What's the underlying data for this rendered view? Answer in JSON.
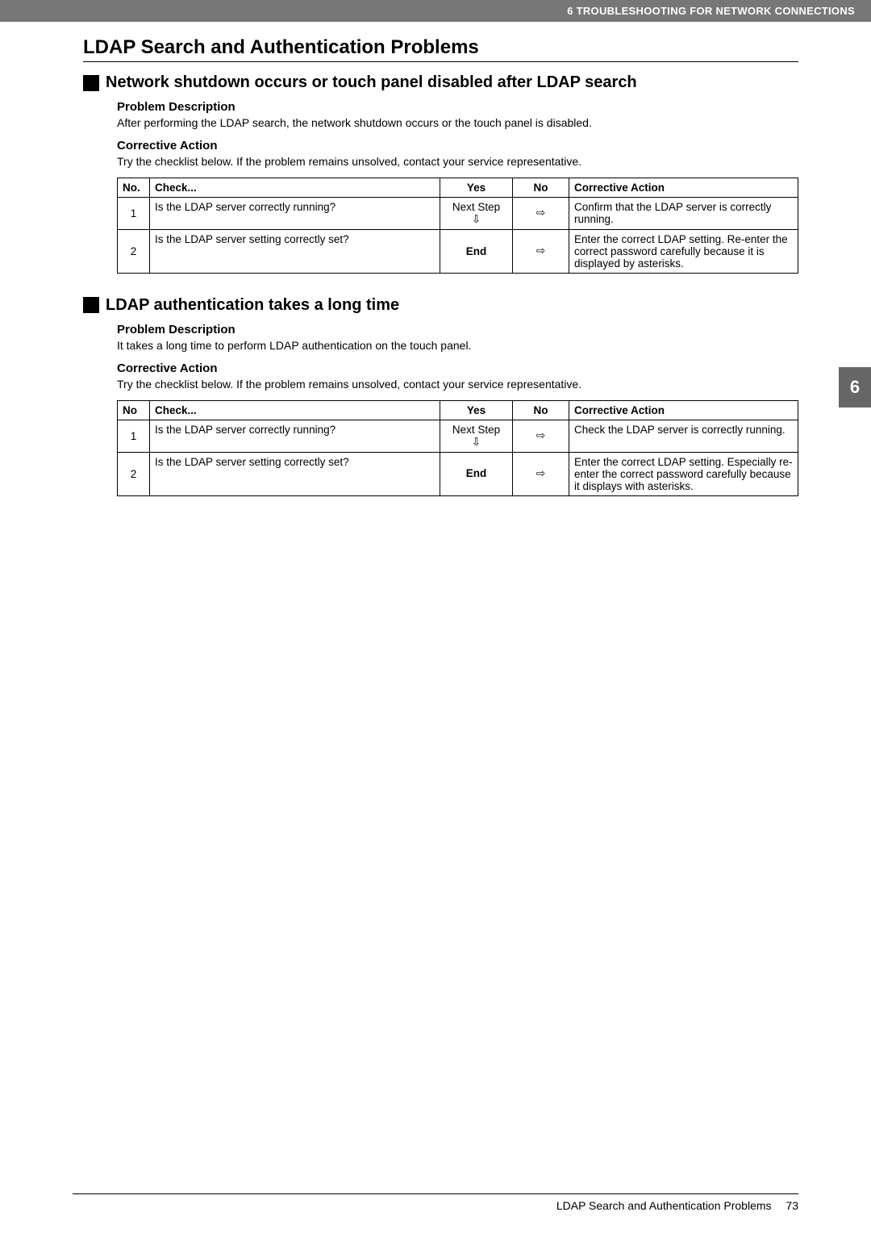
{
  "header": "6 TROUBLESHOOTING FOR NETWORK CONNECTIONS",
  "title": "LDAP Search and Authentication Problems",
  "section1": {
    "heading": "Network shutdown occurs or touch panel disabled after LDAP search",
    "pd_label": "Problem Description",
    "pd_text": "After performing the LDAP search, the network shutdown occurs or the touch panel is disabled.",
    "ca_label": "Corrective Action",
    "ca_text": "Try the checklist below. If the problem remains unsolved, contact your service representative.",
    "table": {
      "headers": {
        "no": "No.",
        "check": "Check...",
        "yes": "Yes",
        "nocol": "No",
        "action": "Corrective Action"
      },
      "rows": [
        {
          "no": "1",
          "check": "Is the LDAP server correctly running?",
          "yes": "Next Step",
          "yes_arrow": "⇩",
          "noarrow": "⇨",
          "action": "Confirm that the LDAP server is correctly running."
        },
        {
          "no": "2",
          "check": "Is the LDAP server setting correctly set?",
          "yes": "End",
          "yes_arrow": "",
          "noarrow": "⇨",
          "action": "Enter the correct LDAP setting. Re-enter the correct password carefully because it is displayed by asterisks."
        }
      ]
    }
  },
  "section2": {
    "heading": "LDAP authentication takes a long time",
    "pd_label": "Problem Description",
    "pd_text": "It takes a long time to perform LDAP authentication on the touch panel.",
    "ca_label": "Corrective Action",
    "ca_text": "Try the checklist below. If the problem remains unsolved, contact your service representative.",
    "table": {
      "headers": {
        "no": "No",
        "check": "Check...",
        "yes": "Yes",
        "nocol": "No",
        "action": "Corrective Action"
      },
      "rows": [
        {
          "no": "1",
          "check": "Is the LDAP server correctly running?",
          "yes": "Next Step",
          "yes_arrow": "⇩",
          "noarrow": "⇨",
          "action": "Check the LDAP server is correctly running."
        },
        {
          "no": "2",
          "check": "Is the LDAP server setting correctly set?",
          "yes": "End",
          "yes_arrow": "",
          "noarrow": "⇨",
          "action": "Enter the correct LDAP setting. Especially re-enter the correct password carefully because it displays with asterisks."
        }
      ]
    }
  },
  "side_tab": "6",
  "footer": {
    "text": "LDAP Search and Authentication Problems",
    "page": "73"
  }
}
